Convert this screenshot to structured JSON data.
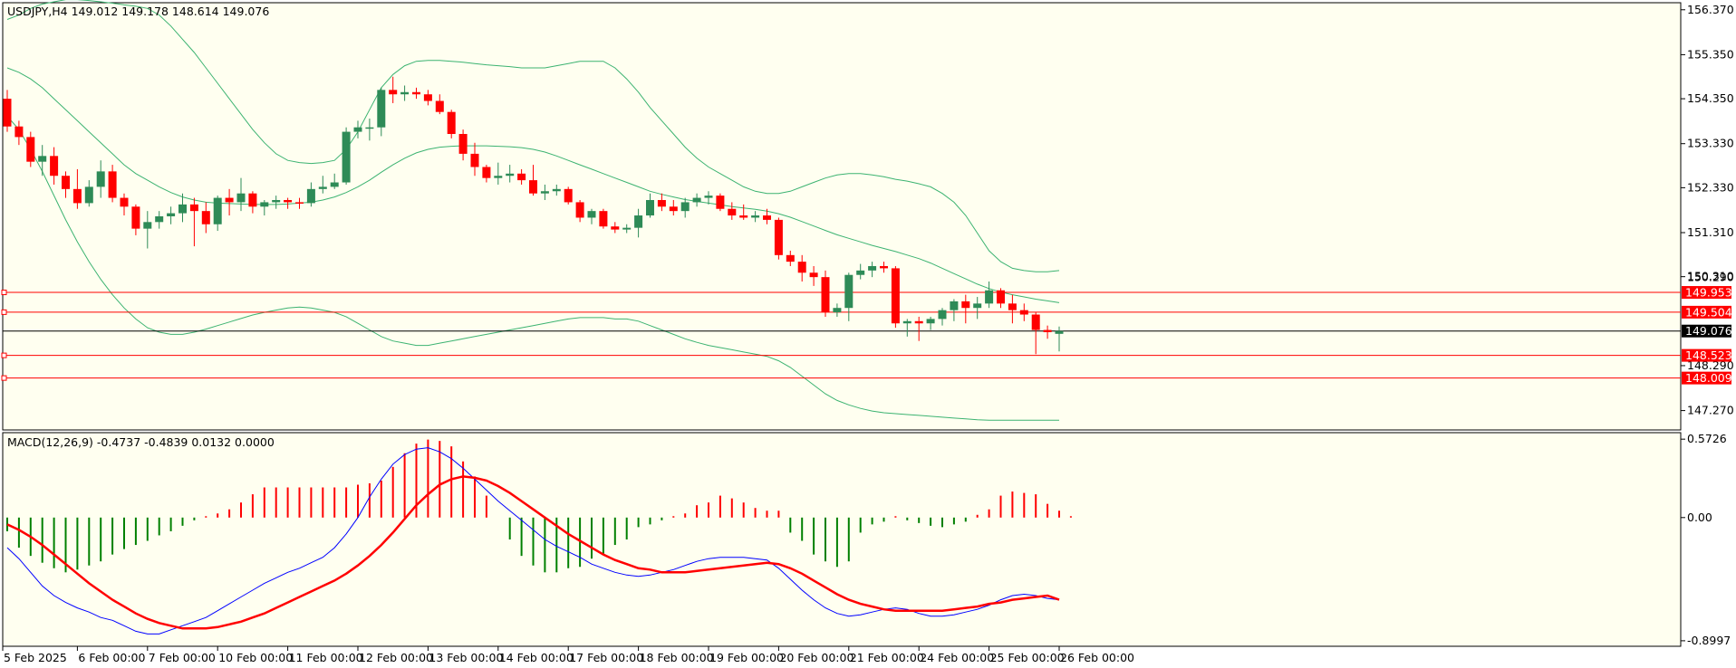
{
  "header": {
    "main": "USDJPY,H4  149.012 149.178 148.614 149.076",
    "macd": "MACD(12,26,9) -0.4737 -0.4839 0.0132 0.0000"
  },
  "colors": {
    "background": "#fffff0",
    "bull_body": "#2e8b57",
    "bear_body": "#ff0000",
    "bands": "#3cb371",
    "level_line": "#ff0000",
    "price_line": "#000000",
    "hist_pos": "#ff0000",
    "hist_neg": "#008000",
    "macd_line": "#0000ff",
    "signal_line": "#ff0000"
  },
  "chart_data": {
    "type": "candlestick",
    "symbol": "USDJPY",
    "timeframe": "H4",
    "price_axis": {
      "ticks": [
        "156.370",
        "155.350",
        "154.350",
        "153.330",
        "152.330",
        "151.310",
        "150.310",
        "148.290",
        "147.270"
      ],
      "tick_values": [
        156.37,
        155.35,
        154.35,
        153.33,
        152.33,
        151.31,
        150.31,
        148.29,
        147.27
      ],
      "partial_label": "150.290",
      "range": [
        146.83,
        156.53
      ]
    },
    "time_axis": {
      "labels": [
        "5 Feb 2025",
        "6 Feb 00:00",
        "7 Feb 00:00",
        "10 Feb 00:00",
        "11 Feb 00:00",
        "12 Feb 00:00",
        "13 Feb 00:00",
        "14 Feb 00:00",
        "17 Feb 00:00",
        "18 Feb 00:00",
        "19 Feb 00:00",
        "20 Feb 00:00",
        "21 Feb 00:00",
        "24 Feb 00:00",
        "25 Feb 00:00",
        "26 Feb 00:00"
      ],
      "label_bar_index": [
        0,
        6,
        12,
        18,
        24,
        30,
        36,
        42,
        48,
        54,
        60,
        66,
        72,
        78,
        84,
        90
      ]
    },
    "candles": [
      {
        "o": 154.35,
        "h": 154.55,
        "l": 153.6,
        "c": 153.72
      },
      {
        "o": 153.72,
        "h": 153.85,
        "l": 153.3,
        "c": 153.48
      },
      {
        "o": 153.48,
        "h": 153.6,
        "l": 152.8,
        "c": 152.92
      },
      {
        "o": 152.92,
        "h": 153.3,
        "l": 152.6,
        "c": 153.05
      },
      {
        "o": 153.05,
        "h": 153.25,
        "l": 152.4,
        "c": 152.6
      },
      {
        "o": 152.6,
        "h": 152.7,
        "l": 152.1,
        "c": 152.3
      },
      {
        "o": 152.3,
        "h": 152.75,
        "l": 151.85,
        "c": 151.98
      },
      {
        "o": 151.98,
        "h": 152.5,
        "l": 151.9,
        "c": 152.35
      },
      {
        "o": 152.35,
        "h": 152.95,
        "l": 152.1,
        "c": 152.7
      },
      {
        "o": 152.7,
        "h": 152.85,
        "l": 152.0,
        "c": 152.1
      },
      {
        "o": 152.1,
        "h": 152.2,
        "l": 151.7,
        "c": 151.9
      },
      {
        "o": 151.9,
        "h": 151.95,
        "l": 151.25,
        "c": 151.4
      },
      {
        "o": 151.4,
        "h": 151.8,
        "l": 150.95,
        "c": 151.55
      },
      {
        "o": 151.55,
        "h": 151.8,
        "l": 151.4,
        "c": 151.68
      },
      {
        "o": 151.68,
        "h": 151.9,
        "l": 151.5,
        "c": 151.75
      },
      {
        "o": 151.75,
        "h": 152.2,
        "l": 151.55,
        "c": 151.95
      },
      {
        "o": 151.95,
        "h": 152.1,
        "l": 151.0,
        "c": 151.8
      },
      {
        "o": 151.8,
        "h": 152.0,
        "l": 151.3,
        "c": 151.5
      },
      {
        "o": 151.5,
        "h": 152.15,
        "l": 151.35,
        "c": 152.1
      },
      {
        "o": 152.1,
        "h": 152.3,
        "l": 151.7,
        "c": 152.0
      },
      {
        "o": 152.0,
        "h": 152.55,
        "l": 151.8,
        "c": 152.2
      },
      {
        "o": 152.2,
        "h": 152.25,
        "l": 151.75,
        "c": 151.9
      },
      {
        "o": 151.9,
        "h": 152.05,
        "l": 151.7,
        "c": 152.0
      },
      {
        "o": 152.0,
        "h": 152.15,
        "l": 151.85,
        "c": 152.05
      },
      {
        "o": 152.05,
        "h": 152.1,
        "l": 151.85,
        "c": 152.0
      },
      {
        "o": 152.0,
        "h": 152.1,
        "l": 151.85,
        "c": 151.98
      },
      {
        "o": 151.98,
        "h": 152.45,
        "l": 151.9,
        "c": 152.3
      },
      {
        "o": 152.3,
        "h": 152.6,
        "l": 152.2,
        "c": 152.35
      },
      {
        "o": 152.35,
        "h": 152.65,
        "l": 152.3,
        "c": 152.45
      },
      {
        "o": 152.45,
        "h": 153.7,
        "l": 152.4,
        "c": 153.6
      },
      {
        "o": 153.6,
        "h": 153.85,
        "l": 153.45,
        "c": 153.7
      },
      {
        "o": 153.7,
        "h": 153.9,
        "l": 153.4,
        "c": 153.7
      },
      {
        "o": 153.7,
        "h": 154.6,
        "l": 153.5,
        "c": 154.55
      },
      {
        "o": 154.55,
        "h": 154.85,
        "l": 154.25,
        "c": 154.45
      },
      {
        "o": 154.45,
        "h": 154.65,
        "l": 154.3,
        "c": 154.5
      },
      {
        "o": 154.5,
        "h": 154.6,
        "l": 154.35,
        "c": 154.45
      },
      {
        "o": 154.45,
        "h": 154.55,
        "l": 154.2,
        "c": 154.3
      },
      {
        "o": 154.3,
        "h": 154.45,
        "l": 154.0,
        "c": 154.05
      },
      {
        "o": 154.05,
        "h": 154.1,
        "l": 153.45,
        "c": 153.55
      },
      {
        "o": 153.55,
        "h": 153.65,
        "l": 152.95,
        "c": 153.1
      },
      {
        "o": 153.1,
        "h": 153.35,
        "l": 152.6,
        "c": 152.8
      },
      {
        "o": 152.8,
        "h": 152.85,
        "l": 152.45,
        "c": 152.55
      },
      {
        "o": 152.55,
        "h": 152.9,
        "l": 152.4,
        "c": 152.6
      },
      {
        "o": 152.6,
        "h": 152.85,
        "l": 152.45,
        "c": 152.65
      },
      {
        "o": 152.65,
        "h": 152.75,
        "l": 152.4,
        "c": 152.5
      },
      {
        "o": 152.5,
        "h": 152.85,
        "l": 152.15,
        "c": 152.2
      },
      {
        "o": 152.2,
        "h": 152.4,
        "l": 152.05,
        "c": 152.25
      },
      {
        "o": 152.25,
        "h": 152.4,
        "l": 152.15,
        "c": 152.3
      },
      {
        "o": 152.3,
        "h": 152.35,
        "l": 151.95,
        "c": 152.0
      },
      {
        "o": 152.0,
        "h": 152.05,
        "l": 151.55,
        "c": 151.65
      },
      {
        "o": 151.65,
        "h": 151.85,
        "l": 151.5,
        "c": 151.8
      },
      {
        "o": 151.8,
        "h": 151.85,
        "l": 151.4,
        "c": 151.45
      },
      {
        "o": 151.45,
        "h": 151.55,
        "l": 151.3,
        "c": 151.38
      },
      {
        "o": 151.38,
        "h": 151.5,
        "l": 151.3,
        "c": 151.42
      },
      {
        "o": 151.42,
        "h": 151.85,
        "l": 151.2,
        "c": 151.7
      },
      {
        "o": 151.7,
        "h": 152.2,
        "l": 151.65,
        "c": 152.05
      },
      {
        "o": 152.05,
        "h": 152.2,
        "l": 151.8,
        "c": 151.9
      },
      {
        "o": 151.9,
        "h": 152.05,
        "l": 151.7,
        "c": 151.8
      },
      {
        "o": 151.8,
        "h": 152.1,
        "l": 151.65,
        "c": 152.0
      },
      {
        "o": 152.0,
        "h": 152.2,
        "l": 151.9,
        "c": 152.1
      },
      {
        "o": 152.1,
        "h": 152.25,
        "l": 151.95,
        "c": 152.15
      },
      {
        "o": 152.15,
        "h": 152.2,
        "l": 151.8,
        "c": 151.85
      },
      {
        "o": 151.85,
        "h": 152.0,
        "l": 151.6,
        "c": 151.7
      },
      {
        "o": 151.7,
        "h": 151.95,
        "l": 151.6,
        "c": 151.65
      },
      {
        "o": 151.65,
        "h": 151.8,
        "l": 151.55,
        "c": 151.7
      },
      {
        "o": 151.7,
        "h": 151.85,
        "l": 151.5,
        "c": 151.6
      },
      {
        "o": 151.6,
        "h": 151.65,
        "l": 150.7,
        "c": 150.8
      },
      {
        "o": 150.8,
        "h": 150.9,
        "l": 150.55,
        "c": 150.65
      },
      {
        "o": 150.65,
        "h": 150.8,
        "l": 150.2,
        "c": 150.4
      },
      {
        "o": 150.4,
        "h": 150.55,
        "l": 150.1,
        "c": 150.3
      },
      {
        "o": 150.3,
        "h": 150.45,
        "l": 149.4,
        "c": 149.5
      },
      {
        "o": 149.5,
        "h": 149.7,
        "l": 149.4,
        "c": 149.6
      },
      {
        "o": 149.6,
        "h": 150.4,
        "l": 149.3,
        "c": 150.35
      },
      {
        "o": 150.35,
        "h": 150.6,
        "l": 150.25,
        "c": 150.45
      },
      {
        "o": 150.45,
        "h": 150.65,
        "l": 150.3,
        "c": 150.55
      },
      {
        "o": 150.55,
        "h": 150.65,
        "l": 150.4,
        "c": 150.5
      },
      {
        "o": 150.5,
        "h": 150.55,
        "l": 149.15,
        "c": 149.25
      },
      {
        "o": 149.25,
        "h": 149.35,
        "l": 148.95,
        "c": 149.3
      },
      {
        "o": 149.3,
        "h": 149.4,
        "l": 148.85,
        "c": 149.25
      },
      {
        "o": 149.25,
        "h": 149.4,
        "l": 149.1,
        "c": 149.35
      },
      {
        "o": 149.35,
        "h": 149.6,
        "l": 149.2,
        "c": 149.55
      },
      {
        "o": 149.55,
        "h": 149.8,
        "l": 149.3,
        "c": 149.75
      },
      {
        "o": 149.75,
        "h": 149.9,
        "l": 149.25,
        "c": 149.6
      },
      {
        "o": 149.6,
        "h": 149.85,
        "l": 149.35,
        "c": 149.7
      },
      {
        "o": 149.7,
        "h": 150.2,
        "l": 149.6,
        "c": 150.0
      },
      {
        "o": 150.0,
        "h": 150.05,
        "l": 149.6,
        "c": 149.7
      },
      {
        "o": 149.7,
        "h": 149.9,
        "l": 149.25,
        "c": 149.55
      },
      {
        "o": 149.55,
        "h": 149.7,
        "l": 149.3,
        "c": 149.45
      },
      {
        "o": 149.45,
        "h": 149.5,
        "l": 148.55,
        "c": 149.1
      },
      {
        "o": 149.1,
        "h": 149.2,
        "l": 148.9,
        "c": 149.05
      },
      {
        "o": 149.012,
        "h": 149.178,
        "l": 148.614,
        "c": 149.076
      }
    ],
    "bollinger": {
      "upper": [
        156.15,
        156.25,
        156.4,
        156.5,
        156.55,
        156.6,
        156.6,
        156.58,
        156.55,
        156.52,
        156.48,
        156.45,
        156.4,
        156.25,
        156.0,
        155.7,
        155.4,
        155.05,
        154.7,
        154.35,
        154.0,
        153.65,
        153.35,
        153.1,
        152.95,
        152.9,
        152.88,
        152.9,
        152.95,
        153.2,
        153.6,
        154.1,
        154.6,
        154.9,
        155.1,
        155.2,
        155.22,
        155.22,
        155.2,
        155.18,
        155.15,
        155.12,
        155.1,
        155.08,
        155.05,
        155.05,
        155.05,
        155.1,
        155.15,
        155.2,
        155.2,
        155.2,
        155.05,
        154.8,
        154.5,
        154.15,
        153.85,
        153.55,
        153.25,
        153.0,
        152.8,
        152.65,
        152.5,
        152.35,
        152.25,
        152.2,
        152.2,
        152.25,
        152.35,
        152.45,
        152.55,
        152.62,
        152.65,
        152.65,
        152.62,
        152.58,
        152.52,
        152.48,
        152.42,
        152.35,
        152.2,
        152.0,
        151.7,
        151.3,
        150.9,
        150.65,
        150.5,
        150.45,
        150.42,
        150.42,
        150.45
      ],
      "middle": [
        155.05,
        154.95,
        154.8,
        154.6,
        154.35,
        154.1,
        153.85,
        153.6,
        153.35,
        153.1,
        152.85,
        152.65,
        152.5,
        152.35,
        152.22,
        152.12,
        152.05,
        152.0,
        151.98,
        151.97,
        151.96,
        151.95,
        151.95,
        151.95,
        151.96,
        151.98,
        152.0,
        152.05,
        152.12,
        152.22,
        152.35,
        152.5,
        152.68,
        152.85,
        153.0,
        153.12,
        153.2,
        153.25,
        153.27,
        153.28,
        153.28,
        153.28,
        153.27,
        153.26,
        153.24,
        153.2,
        153.14,
        153.05,
        152.95,
        152.85,
        152.75,
        152.65,
        152.55,
        152.45,
        152.35,
        152.25,
        152.18,
        152.12,
        152.06,
        152.02,
        151.98,
        151.94,
        151.9,
        151.87,
        151.84,
        151.8,
        151.74,
        151.66,
        151.56,
        151.46,
        151.36,
        151.26,
        151.18,
        151.1,
        151.02,
        150.95,
        150.88,
        150.8,
        150.72,
        150.62,
        150.5,
        150.38,
        150.26,
        150.14,
        150.04,
        149.96,
        149.9,
        149.85,
        149.8,
        149.76,
        149.72
      ],
      "lower": [
        153.95,
        153.65,
        153.2,
        152.7,
        152.15,
        151.6,
        151.1,
        150.65,
        150.25,
        149.9,
        149.6,
        149.35,
        149.15,
        149.05,
        149.0,
        149.0,
        149.05,
        149.12,
        149.2,
        149.28,
        149.36,
        149.44,
        149.5,
        149.55,
        149.6,
        149.62,
        149.6,
        149.55,
        149.5,
        149.4,
        149.25,
        149.1,
        148.95,
        148.85,
        148.8,
        148.75,
        148.75,
        148.8,
        148.85,
        148.9,
        148.95,
        149.0,
        149.05,
        149.1,
        149.15,
        149.2,
        149.25,
        149.3,
        149.35,
        149.38,
        149.38,
        149.38,
        149.35,
        149.35,
        149.3,
        149.2,
        149.1,
        149.0,
        148.9,
        148.82,
        148.75,
        148.7,
        148.65,
        148.6,
        148.55,
        148.5,
        148.4,
        148.25,
        148.05,
        147.85,
        147.65,
        147.5,
        147.4,
        147.32,
        147.26,
        147.22,
        147.2,
        147.18,
        147.16,
        147.14,
        147.12,
        147.1,
        147.08,
        147.06,
        147.05,
        147.05,
        147.05,
        147.05,
        147.05,
        147.05,
        147.05
      ]
    },
    "levels": [
      {
        "label": "149.953",
        "value": 149.953
      },
      {
        "label": "149.504",
        "value": 149.504
      },
      {
        "label": "148.523",
        "value": 148.523
      },
      {
        "label": "148.009",
        "value": 148.009
      }
    ],
    "last_price": {
      "label": "149.076",
      "value": 149.076
    },
    "macd": {
      "axis_ticks": [
        "0.5726",
        "0.00",
        "-0.8997"
      ],
      "tick_values": [
        0.5726,
        0.0,
        -0.8997
      ],
      "range": [
        -0.94,
        0.62
      ],
      "histogram": [
        -0.1,
        -0.22,
        -0.28,
        -0.33,
        -0.37,
        -0.4,
        -0.38,
        -0.35,
        -0.32,
        -0.27,
        -0.23,
        -0.2,
        -0.17,
        -0.13,
        -0.1,
        -0.06,
        -0.02,
        0.01,
        0.03,
        0.06,
        0.11,
        0.17,
        0.22,
        0.22,
        0.22,
        0.22,
        0.22,
        0.22,
        0.22,
        0.22,
        0.24,
        0.25,
        0.27,
        0.37,
        0.47,
        0.54,
        0.57,
        0.56,
        0.52,
        0.41,
        0.3,
        0.16,
        0.0,
        -0.16,
        -0.28,
        -0.35,
        -0.4,
        -0.4,
        -0.37,
        -0.36,
        -0.3,
        -0.27,
        -0.2,
        -0.16,
        -0.07,
        -0.05,
        -0.02,
        0.01,
        0.03,
        0.09,
        0.11,
        0.16,
        0.14,
        0.11,
        0.07,
        0.05,
        0.05,
        -0.11,
        -0.17,
        -0.27,
        -0.32,
        -0.36,
        -0.32,
        -0.11,
        -0.05,
        -0.03,
        0.01,
        -0.02,
        -0.04,
        -0.06,
        -0.07,
        -0.05,
        -0.03,
        0.02,
        0.06,
        0.16,
        0.19,
        0.18,
        0.17,
        0.1,
        0.05,
        0.01
      ],
      "macd_line": [
        -0.22,
        -0.3,
        -0.4,
        -0.5,
        -0.57,
        -0.62,
        -0.66,
        -0.69,
        -0.73,
        -0.75,
        -0.79,
        -0.83,
        -0.85,
        -0.85,
        -0.82,
        -0.79,
        -0.76,
        -0.73,
        -0.68,
        -0.63,
        -0.58,
        -0.53,
        -0.48,
        -0.44,
        -0.4,
        -0.37,
        -0.33,
        -0.29,
        -0.22,
        -0.12,
        0.0,
        0.15,
        0.28,
        0.39,
        0.46,
        0.5,
        0.51,
        0.48,
        0.43,
        0.36,
        0.28,
        0.2,
        0.12,
        0.05,
        -0.02,
        -0.09,
        -0.16,
        -0.21,
        -0.25,
        -0.29,
        -0.34,
        -0.37,
        -0.4,
        -0.42,
        -0.43,
        -0.42,
        -0.4,
        -0.38,
        -0.35,
        -0.32,
        -0.3,
        -0.29,
        -0.29,
        -0.29,
        -0.3,
        -0.31,
        -0.37,
        -0.45,
        -0.53,
        -0.6,
        -0.66,
        -0.7,
        -0.72,
        -0.71,
        -0.69,
        -0.67,
        -0.66,
        -0.67,
        -0.7,
        -0.72,
        -0.72,
        -0.71,
        -0.69,
        -0.67,
        -0.64,
        -0.6,
        -0.57,
        -0.56,
        -0.57,
        -0.59,
        -0.6
      ],
      "signal_line": [
        -0.05,
        -0.09,
        -0.14,
        -0.2,
        -0.27,
        -0.34,
        -0.41,
        -0.48,
        -0.54,
        -0.6,
        -0.65,
        -0.7,
        -0.74,
        -0.77,
        -0.79,
        -0.81,
        -0.81,
        -0.81,
        -0.8,
        -0.78,
        -0.76,
        -0.73,
        -0.7,
        -0.66,
        -0.62,
        -0.58,
        -0.54,
        -0.5,
        -0.46,
        -0.41,
        -0.35,
        -0.28,
        -0.2,
        -0.11,
        -0.01,
        0.09,
        0.17,
        0.24,
        0.28,
        0.3,
        0.29,
        0.27,
        0.23,
        0.18,
        0.12,
        0.06,
        0.0,
        -0.06,
        -0.12,
        -0.17,
        -0.22,
        -0.27,
        -0.31,
        -0.34,
        -0.37,
        -0.38,
        -0.4,
        -0.4,
        -0.4,
        -0.39,
        -0.38,
        -0.37,
        -0.36,
        -0.35,
        -0.34,
        -0.33,
        -0.34,
        -0.37,
        -0.41,
        -0.46,
        -0.51,
        -0.56,
        -0.6,
        -0.63,
        -0.65,
        -0.67,
        -0.68,
        -0.68,
        -0.68,
        -0.68,
        -0.68,
        -0.67,
        -0.66,
        -0.65,
        -0.63,
        -0.62,
        -0.6,
        -0.59,
        -0.58,
        -0.57,
        -0.6
      ]
    }
  }
}
